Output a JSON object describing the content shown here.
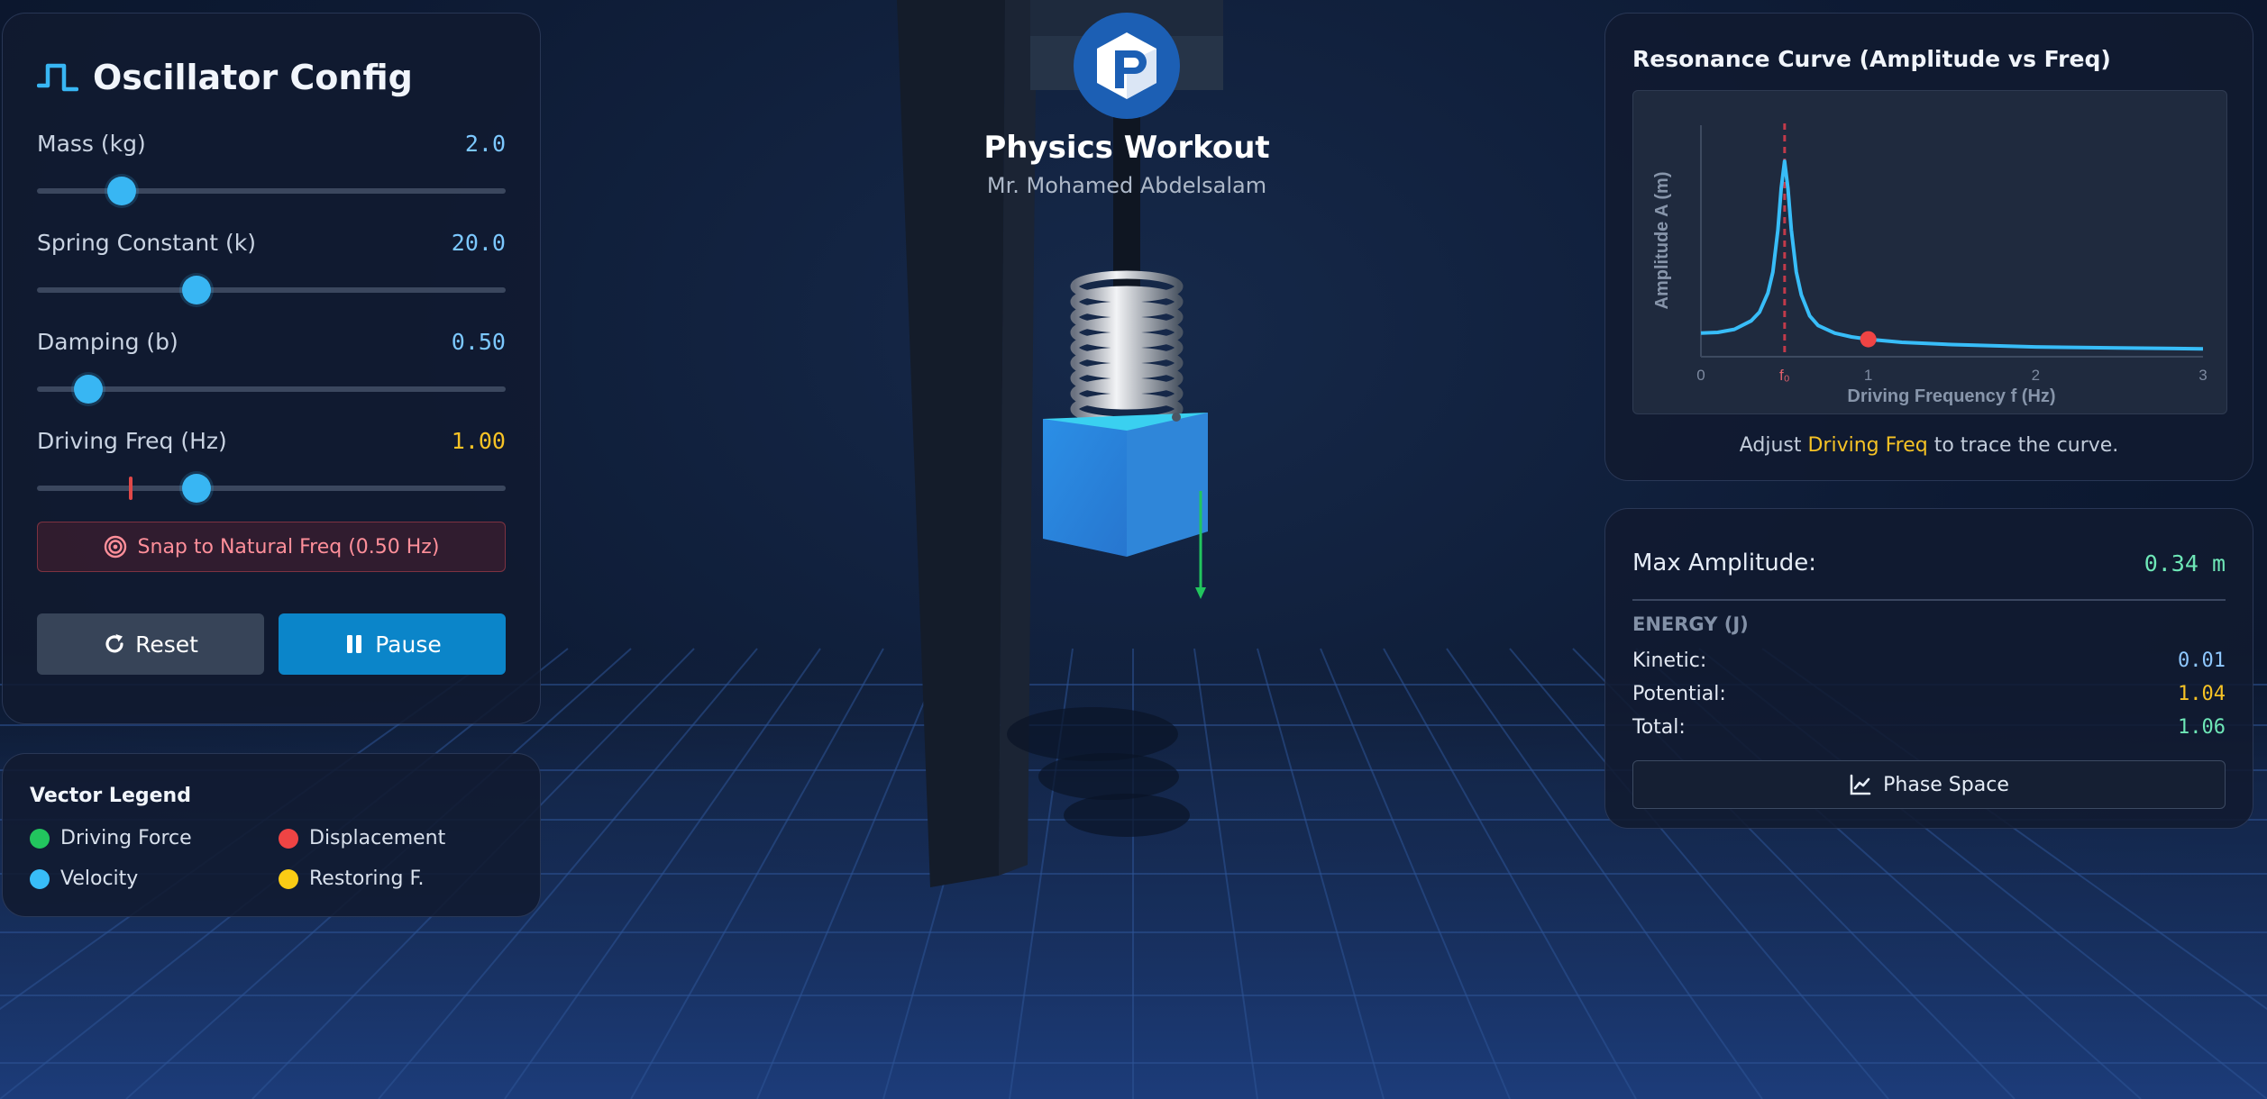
{
  "config": {
    "title": "Oscillator Config",
    "params": [
      {
        "label": "Mass (kg)",
        "value": "2.0",
        "slider_fraction": 0.18
      },
      {
        "label": "Spring Constant (k)",
        "value": "20.0",
        "slider_fraction": 0.34
      },
      {
        "label": "Damping (b)",
        "value": "0.50",
        "slider_fraction": 0.11
      },
      {
        "label": "Driving Freq (Hz)",
        "value": "1.00",
        "slider_fraction": 0.34,
        "natural_marker_fraction": 0.2
      }
    ],
    "snap_label": "Snap to Natural Freq (0.50 Hz)",
    "reset_label": "Reset",
    "pause_label": "Pause"
  },
  "legend": {
    "title": "Vector Legend",
    "items": [
      {
        "label": "Driving Force",
        "color": "#22c55e"
      },
      {
        "label": "Displacement",
        "color": "#ef4444"
      },
      {
        "label": "Velocity",
        "color": "#38bdf8"
      },
      {
        "label": "Restoring F.",
        "color": "#facc15"
      }
    ]
  },
  "brand": {
    "title": "Physics Workout",
    "subtitle": "Mr. Mohamed Abdelsalam"
  },
  "resonance": {
    "title": "Resonance Curve (Amplitude vs Freq)",
    "hint_prefix": "Adjust ",
    "hint_highlight": "Driving Freq",
    "hint_suffix": " to trace the curve."
  },
  "chart_data": {
    "type": "line",
    "title": "",
    "xlabel": "Driving Frequency f (Hz)",
    "ylabel": "Amplitude A (m)",
    "xlim": [
      0,
      3
    ],
    "x_ticks": [
      "0",
      "f₀",
      "1",
      "2",
      "3"
    ],
    "natural_frequency": 0.5,
    "natural_label": "f₀",
    "current_point": {
      "x": 1.0,
      "y": 0.34
    },
    "series": [
      {
        "color": "#38bdf8",
        "x": [
          0,
          0.1,
          0.2,
          0.3,
          0.35,
          0.4,
          0.43,
          0.46,
          0.48,
          0.5,
          0.52,
          0.54,
          0.57,
          0.6,
          0.65,
          0.7,
          0.8,
          0.9,
          1.0,
          1.2,
          1.5,
          2.0,
          2.5,
          3.0
        ],
        "y": [
          0.5,
          0.52,
          0.6,
          0.82,
          1.05,
          1.55,
          2.1,
          3.2,
          4.3,
          5.0,
          4.3,
          3.2,
          2.1,
          1.5,
          0.95,
          0.7,
          0.5,
          0.4,
          0.34,
          0.26,
          0.2,
          0.14,
          0.11,
          0.09
        ]
      }
    ],
    "colors": {
      "curve": "#38bdf8",
      "marker": "#ef4444",
      "f0_line": "#c23a4a"
    }
  },
  "stats": {
    "max_amplitude_label": "Max Amplitude:",
    "max_amplitude_value": "0.34 m",
    "energy_title": "ENERGY (J)",
    "kinetic_label": "Kinetic:",
    "kinetic_value": "0.01",
    "potential_label": "Potential:",
    "potential_value": "1.04",
    "total_label": "Total:",
    "total_value": "1.06",
    "phase_label": "Phase Space"
  }
}
